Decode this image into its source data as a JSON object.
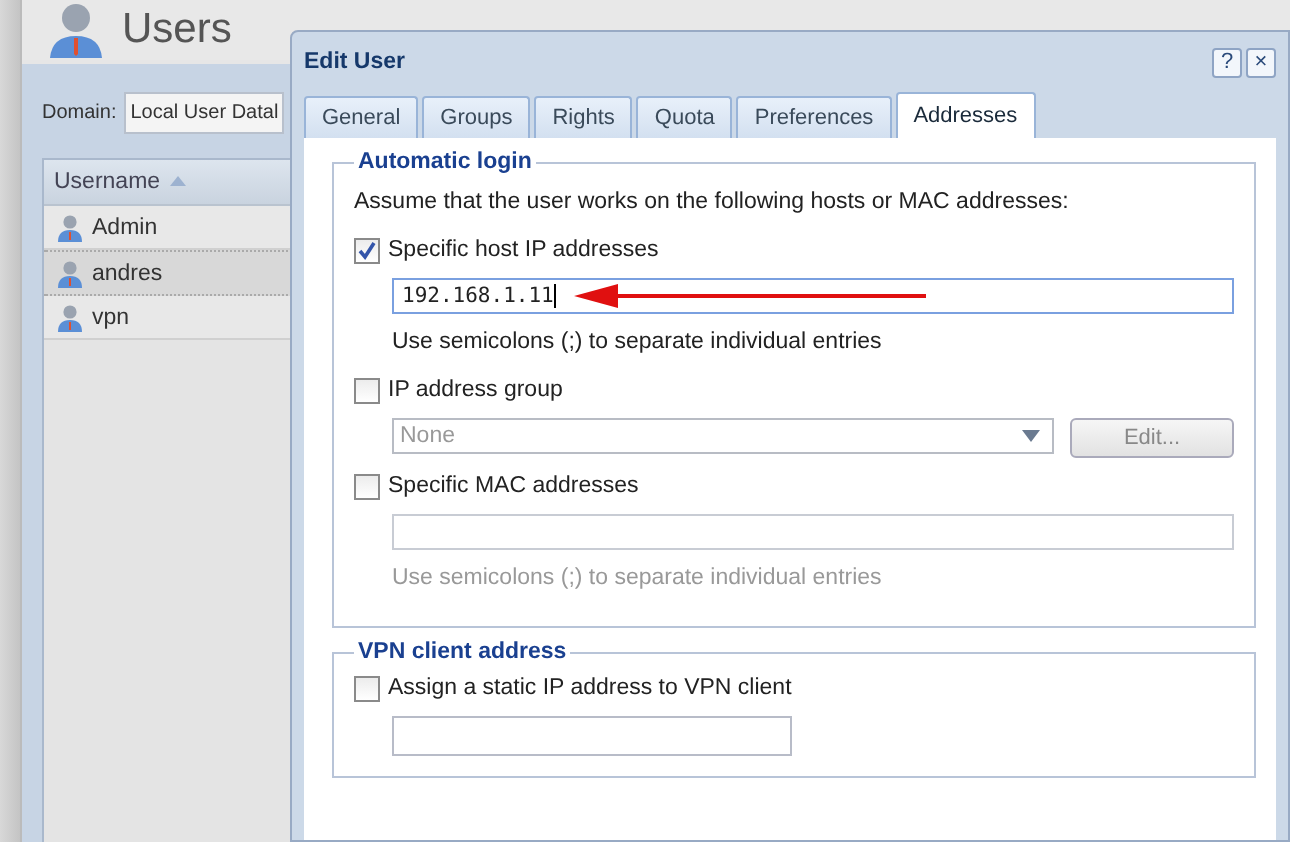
{
  "app": {
    "title": "Users",
    "domain_label": "Domain:",
    "domain_value": "Local User Datal",
    "grid": {
      "columns": [
        {
          "label": "Username",
          "sorted": true
        }
      ],
      "rows": [
        {
          "name": "Admin",
          "selected": false
        },
        {
          "name": "andres",
          "selected": true
        },
        {
          "name": "vpn",
          "selected": false
        }
      ]
    }
  },
  "dialog": {
    "title": "Edit User",
    "help": "?",
    "close": "×",
    "tabs": [
      {
        "label": "General",
        "selected": false
      },
      {
        "label": "Groups",
        "selected": false
      },
      {
        "label": "Rights",
        "selected": false
      },
      {
        "label": "Quota",
        "selected": false
      },
      {
        "label": "Preferences",
        "selected": false
      },
      {
        "label": "Addresses",
        "selected": true
      }
    ],
    "sections": [
      {
        "title": "Automatic login",
        "items": [
          {
            "kind": "text",
            "text": "Assume that the user works on the following hosts or MAC addresses:"
          },
          {
            "kind": "checkbox",
            "label": "Specific host IP addresses",
            "checked": true
          },
          {
            "kind": "field",
            "value": "192.168.1.11",
            "disabled": false,
            "arrow": true
          },
          {
            "kind": "hint",
            "text": "Use semicolons (;) to separate individual entries",
            "disabled": false
          },
          {
            "kind": "checkbox",
            "label": "IP address group",
            "checked": false
          },
          {
            "kind": "select",
            "placeholder": "None",
            "button": "Edit...",
            "disabled": true
          },
          {
            "kind": "checkbox",
            "label": "Specific MAC addresses",
            "checked": false
          },
          {
            "kind": "field",
            "value": "",
            "disabled": true
          },
          {
            "kind": "hint",
            "text": "Use semicolons (;) to separate individual entries",
            "disabled": true
          }
        ]
      },
      {
        "title": "VPN client address",
        "items": [
          {
            "kind": "checkbox",
            "label": "Assign a static IP address to VPN client",
            "checked": false
          },
          {
            "kind": "shortfield",
            "value": "",
            "disabled": false
          }
        ]
      }
    ]
  }
}
